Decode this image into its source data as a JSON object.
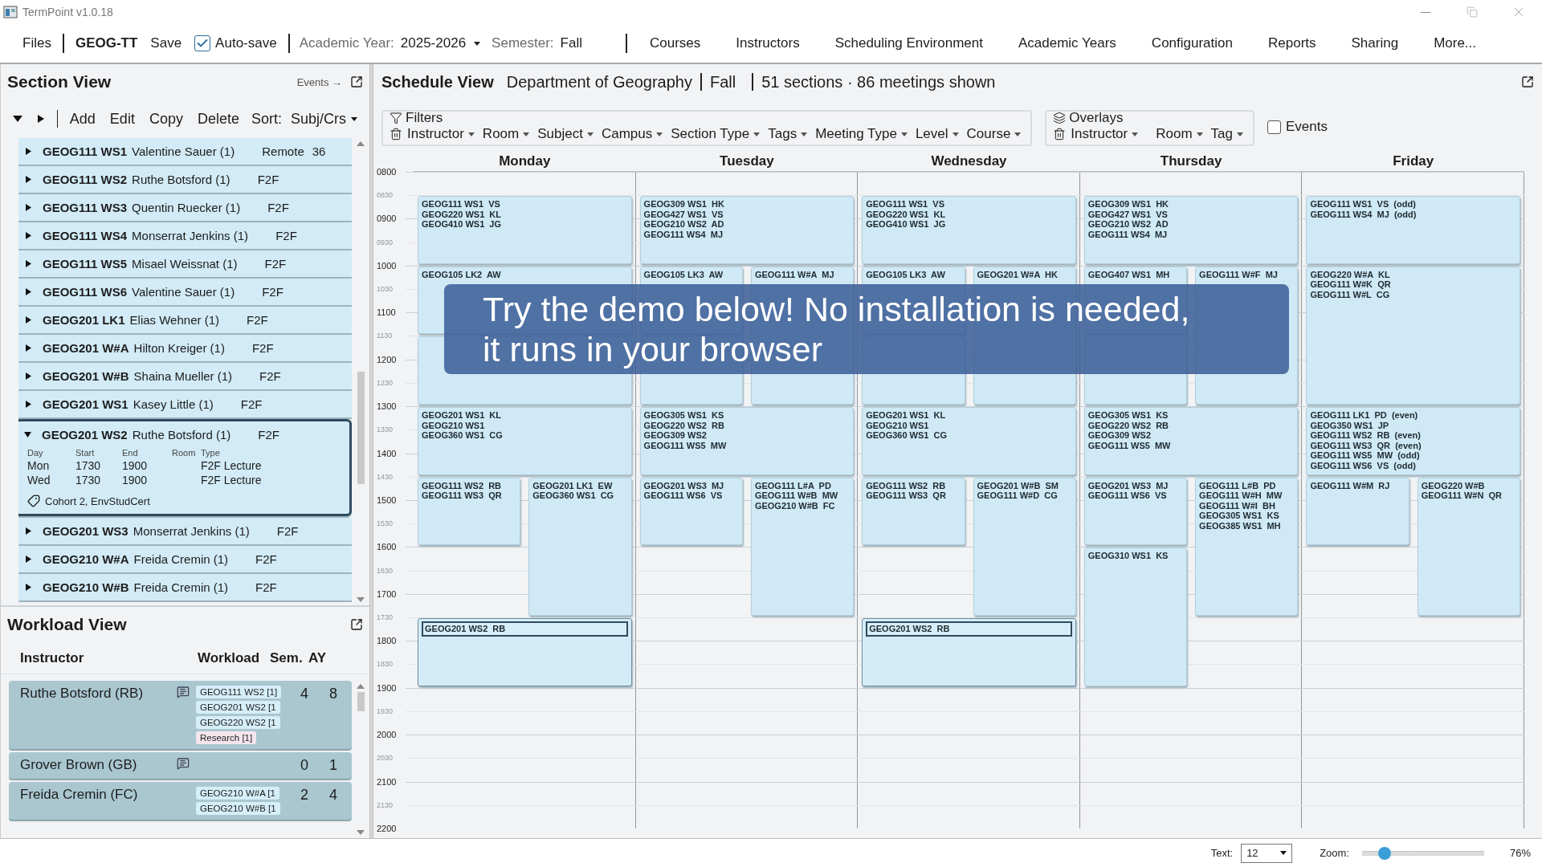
{
  "window": {
    "title": "TermPoint v1.0.18"
  },
  "menu": {
    "files": "Files",
    "project": "GEOG-TT",
    "save": "Save",
    "autosave": {
      "label": "Auto-save",
      "checked": true
    },
    "year_label": "Academic Year:",
    "year": "2025-2026",
    "semester_label": "Semester:",
    "semester": "Fall",
    "items": [
      "Courses",
      "Instructors",
      "Scheduling Environment",
      "Academic Years",
      "Configuration",
      "Reports",
      "Sharing",
      "More..."
    ]
  },
  "section_view": {
    "title": "Section View",
    "events_link": "Events →",
    "actions": [
      "Add",
      "Edit",
      "Copy",
      "Delete"
    ],
    "sort_label": "Sort:",
    "sort_value": "Subj/Crs",
    "sections": [
      {
        "code": "GEOG111 WS1",
        "instructor": "Valentine Sauer (1)",
        "delivery": "Remote",
        "seats": "36",
        "expanded": false
      },
      {
        "code": "GEOG111 WS2",
        "instructor": "Ruthe Botsford (1)",
        "delivery": "F2F",
        "expanded": false
      },
      {
        "code": "GEOG111 WS3",
        "instructor": "Quentin Ruecker (1)",
        "delivery": "F2F",
        "expanded": false
      },
      {
        "code": "GEOG111 WS4",
        "instructor": "Monserrat Jenkins (1)",
        "delivery": "F2F",
        "expanded": false
      },
      {
        "code": "GEOG111 WS5",
        "instructor": "Misael Weissnat (1)",
        "delivery": "F2F",
        "expanded": false
      },
      {
        "code": "GEOG111 WS6",
        "instructor": "Valentine Sauer (1)",
        "delivery": "F2F",
        "expanded": false
      },
      {
        "code": "GEOG201 LK1",
        "instructor": "Elias Wehner (1)",
        "delivery": "F2F",
        "expanded": false
      },
      {
        "code": "GEOG201 W#A",
        "instructor": "Hilton Kreiger (1)",
        "delivery": "F2F",
        "expanded": false
      },
      {
        "code": "GEOG201 W#B",
        "instructor": "Shaina Mueller (1)",
        "delivery": "F2F",
        "expanded": false
      },
      {
        "code": "GEOG201 WS1",
        "instructor": "Kasey Little (1)",
        "delivery": "F2F",
        "expanded": false
      },
      {
        "code": "GEOG201 WS2",
        "instructor": "Ruthe Botsford (1)",
        "delivery": "F2F",
        "expanded": true,
        "meeting_columns": [
          "Day",
          "Start",
          "End",
          "Room",
          "Type"
        ],
        "meetings": [
          {
            "day": "Mon",
            "start": "1730",
            "end": "1900",
            "type": "F2F Lecture"
          },
          {
            "day": "Wed",
            "start": "1730",
            "end": "1900",
            "type": "F2F Lecture"
          }
        ],
        "tags": "Cohort 2, EnvStudCert"
      },
      {
        "code": "GEOG201 WS3",
        "instructor": "Monserrat Jenkins (1)",
        "delivery": "F2F",
        "expanded": false
      },
      {
        "code": "GEOG210 W#A",
        "instructor": "Freida Cremin (1)",
        "delivery": "F2F",
        "expanded": false
      },
      {
        "code": "GEOG210 W#B",
        "instructor": "Freida Cremin (1)",
        "delivery": "F2F",
        "expanded": false
      }
    ]
  },
  "workload_view": {
    "title": "Workload View",
    "columns": [
      "Instructor",
      "Workload",
      "Sem.",
      "AY"
    ],
    "rows": [
      {
        "name": "Ruthe Botsford (RB)",
        "note": true,
        "items": [
          {
            "label": "GEOG111 WS2 [1]",
            "kind": "section"
          },
          {
            "label": "GEOG201 WS2 [1",
            "kind": "section"
          },
          {
            "label": "GEOG220 WS2 [1",
            "kind": "section"
          },
          {
            "label": "Research [1]",
            "kind": "other"
          }
        ],
        "sem": "4",
        "ay": "8"
      },
      {
        "name": "Grover Brown (GB)",
        "note": true,
        "sem": "0",
        "ay": "1"
      },
      {
        "name": "Freida Cremin (FC)",
        "note": false,
        "items": [
          {
            "label": "GEOG210 W#A [1",
            "kind": "section"
          },
          {
            "label": "GEOG210 W#B [1",
            "kind": "section"
          }
        ],
        "sem": "2",
        "ay": "4"
      }
    ]
  },
  "schedule_view": {
    "title": "Schedule View",
    "department": "Department of Geography",
    "semester": "Fall",
    "summary": "51 sections · 86 meetings shown",
    "filters": {
      "title": "Filters",
      "items": [
        "Instructor",
        "Room",
        "Subject",
        "Campus",
        "Section Type",
        "Tags",
        "Meeting Type",
        "Level",
        "Course"
      ]
    },
    "overlays": {
      "title": "Overlays",
      "items": [
        "Instructor",
        "Room",
        "Tag"
      ]
    },
    "events": {
      "label": "Events",
      "checked": false
    },
    "time_labels": [
      {
        "label": "0800",
        "kind": "hour"
      },
      {
        "label": "0830",
        "kind": "half"
      },
      {
        "label": "0900",
        "kind": "hour"
      },
      {
        "label": "0930",
        "kind": "half"
      },
      {
        "label": "1000",
        "kind": "hour"
      },
      {
        "label": "1030",
        "kind": "half"
      },
      {
        "label": "1100",
        "kind": "hour"
      },
      {
        "label": "1130",
        "kind": "half"
      },
      {
        "label": "1200",
        "kind": "hour"
      },
      {
        "label": "1230",
        "kind": "half"
      },
      {
        "label": "1300",
        "kind": "hour"
      },
      {
        "label": "1330",
        "kind": "half"
      },
      {
        "label": "1400",
        "kind": "hour"
      },
      {
        "label": "1430",
        "kind": "half"
      },
      {
        "label": "1500",
        "kind": "hour"
      },
      {
        "label": "1530",
        "kind": "half"
      },
      {
        "label": "1600",
        "kind": "hour"
      },
      {
        "label": "1630",
        "kind": "half"
      },
      {
        "label": "1700",
        "kind": "hour"
      },
      {
        "label": "1730",
        "kind": "half"
      },
      {
        "label": "1800",
        "kind": "hour"
      },
      {
        "label": "1830",
        "kind": "half"
      },
      {
        "label": "1900",
        "kind": "hour"
      },
      {
        "label": "1930",
        "kind": "half"
      },
      {
        "label": "2000",
        "kind": "hour"
      },
      {
        "label": "2030",
        "kind": "half"
      },
      {
        "label": "2100",
        "kind": "hour"
      },
      {
        "label": "2130",
        "kind": "half"
      },
      {
        "label": "2200",
        "kind": "hour"
      }
    ],
    "days": [
      {
        "name": "Monday",
        "meetings": [
          {
            "kind": "full",
            "selected": false,
            "lines": [
              "GEOG111 WS1  VS",
              "GEOG220 WS1  KL",
              "GEOG410 WS1  JG"
            ]
          },
          {
            "kind": "full",
            "selected": false,
            "lines": [
              "GEOG105 LK2  AW"
            ]
          },
          {
            "kind": "full",
            "selected": false
          },
          {
            "kind": "full",
            "selected": false,
            "lines": [
              "GEOG201 WS1  KL",
              "GEOG210 WS1",
              "GEOG360 WS1  CG"
            ]
          },
          {
            "kind": "left",
            "selected": false,
            "lines": [
              "GEOG111 WS2  RB",
              "GEOG111 WS3  QR"
            ]
          },
          {
            "kind": "right",
            "selected": false,
            "lines": [
              "GEOG201 LK1  EW",
              "GEOG360 WS1  CG"
            ]
          },
          {
            "kind": "full",
            "selected": true,
            "lines": [
              "GEOG201 WS2  RB"
            ]
          }
        ]
      },
      {
        "name": "Tuesday",
        "meetings": [
          {
            "kind": "full",
            "selected": false,
            "lines": [
              "GEOG309 WS1  HK",
              "GEOG427 WS1  VS",
              "GEOG210 WS2  AD",
              "GEOG111 WS4  MJ"
            ]
          },
          {
            "kind": "left",
            "selected": false,
            "lines": [
              "GEOG105 LK3  AW"
            ]
          },
          {
            "kind": "right",
            "selected": false,
            "lines": [
              "GEOG111 W#A  MJ"
            ]
          },
          {
            "kind": "left",
            "selected": false
          },
          {
            "kind": "full",
            "selected": false,
            "lines": [
              "GEOG305 WS1  KS",
              "GEOG220 WS2  RB",
              "GEOG309 WS2",
              "GEOG111 WS5  MW"
            ]
          },
          {
            "kind": "left",
            "selected": false,
            "lines": [
              "GEOG201 WS3  MJ",
              "GEOG111 WS6  VS"
            ]
          },
          {
            "kind": "right",
            "selected": false,
            "lines": [
              "GEOG111 L#A  PD",
              "GEOG111 W#B  MW",
              "GEOG210 W#B  FC"
            ]
          }
        ]
      },
      {
        "name": "Wednesday",
        "meetings": [
          {
            "kind": "full",
            "selected": false,
            "lines": [
              "GEOG111 WS1  VS",
              "GEOG220 WS1  KL",
              "GEOG410 WS1  JG"
            ]
          },
          {
            "kind": "left",
            "selected": false,
            "lines": [
              "GEOG105 LK3  AW"
            ]
          },
          {
            "kind": "right",
            "selected": false,
            "lines": [
              "GEOG201 W#A  HK"
            ]
          },
          {
            "kind": "left",
            "selected": false
          },
          {
            "kind": "full",
            "selected": false,
            "lines": [
              "GEOG201 WS1  KL",
              "GEOG210 WS1",
              "GEOG360 WS1  CG"
            ]
          },
          {
            "kind": "left",
            "selected": false,
            "lines": [
              "GEOG111 WS2  RB",
              "GEOG111 WS3  QR"
            ]
          },
          {
            "kind": "right",
            "selected": false,
            "lines": [
              "GEOG201 W#B  SM",
              "GEOG111 W#D  CG"
            ]
          },
          {
            "kind": "full",
            "selected": true,
            "lines": [
              "GEOG201 WS2  RB"
            ]
          }
        ]
      },
      {
        "name": "Thursday",
        "meetings": [
          {
            "kind": "full",
            "selected": false,
            "lines": [
              "GEOG309 WS1  HK",
              "GEOG427 WS1  VS",
              "GEOG210 WS2  AD",
              "GEOG111 WS4  MJ"
            ]
          },
          {
            "kind": "left",
            "selected": false,
            "lines": [
              "GEOG407 WS1  MH"
            ]
          },
          {
            "kind": "right",
            "selected": false,
            "lines": [
              "GEOG111 W#F  MJ"
            ]
          },
          {
            "kind": "left",
            "selected": false
          },
          {
            "kind": "full",
            "selected": false,
            "lines": [
              "GEOG305 WS1  KS",
              "GEOG220 WS2  RB",
              "GEOG309 WS2",
              "GEOG111 WS5  MW"
            ]
          },
          {
            "kind": "left",
            "selected": false,
            "lines": [
              "GEOG201 WS3  MJ",
              "GEOG111 WS6  VS"
            ]
          },
          {
            "kind": "right",
            "selected": false,
            "lines": [
              "GEOG111 L#B  PD",
              "GEOG111 W#H  MW",
              "GEOG111 W#I  BH",
              "GEOG305 WS1  KS",
              "GEOG385 WS1  MH"
            ]
          },
          {
            "kind": "left",
            "selected": false,
            "lines": [
              "GEOG310 WS1  KS"
            ]
          }
        ]
      },
      {
        "name": "Friday",
        "meetings": [
          {
            "kind": "full",
            "selected": false,
            "lines": [
              "GEOG111 WS1  VS  (odd)",
              "GEOG111 WS4  MJ  (odd)"
            ]
          },
          {
            "kind": "full",
            "selected": false,
            "lines": [
              "GEOG220 W#A  KL",
              "GEOG111 W#K  QR",
              "GEOG111 W#L  CG"
            ]
          },
          {
            "kind": "full",
            "selected": false,
            "lines": [
              "GEOG111 LK1  PD  (even)",
              "GEOG350 WS1  JP",
              "GEOG111 WS2  RB  (even)",
              "GEOG111 WS3  QR  (even)",
              "GEOG111 WS5  MW  (odd)",
              "GEOG111 WS6  VS  (odd)"
            ]
          },
          {
            "kind": "left",
            "selected": false,
            "lines": [
              "GEOG111 W#M  RJ"
            ]
          },
          {
            "kind": "right",
            "selected": false,
            "lines": [
              "GEOG220 W#B",
              "GEOG111 W#N  QR"
            ]
          }
        ]
      }
    ]
  },
  "banner": {
    "text": "Try the demo below! No installation is needed,\nit runs in your browser"
  },
  "status_bar": {
    "text_label": "Text:",
    "text_size": "12",
    "zoom_label": "Zoom:",
    "zoom": {
      "level": 0.15
    },
    "zoom_reading": "76%"
  }
}
